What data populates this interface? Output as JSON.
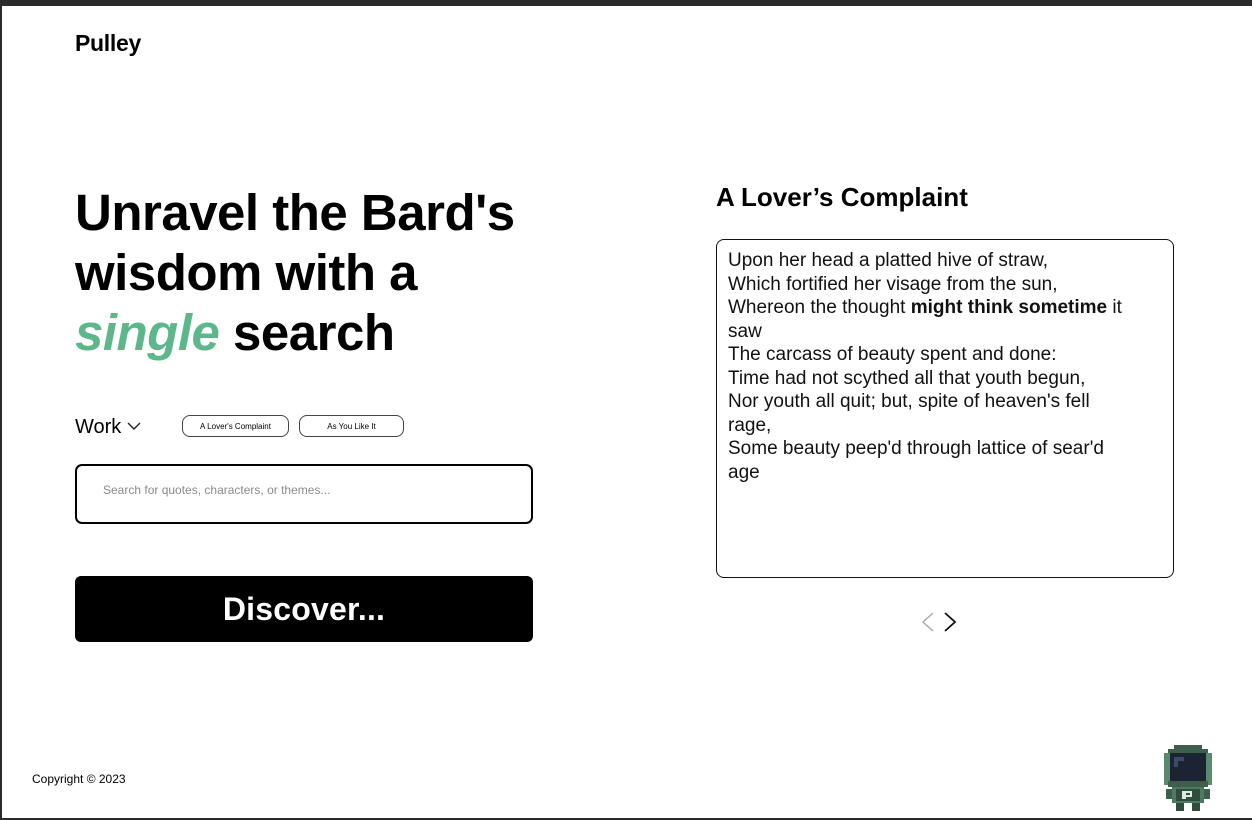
{
  "brand": {
    "logo_text": "Pulley"
  },
  "hero": {
    "line1": "Unravel the Bard's",
    "line2": "wisdom with a",
    "accent_word": "single",
    "line3_rest": " search",
    "accent_color": "#5cb88a"
  },
  "filters": {
    "work_label": "Work",
    "chips": [
      "A Lover's Complaint",
      "As You Like It"
    ]
  },
  "search": {
    "placeholder": "Search for quotes, characters, or themes...",
    "value": ""
  },
  "discover_button": {
    "label": "Discover..."
  },
  "result": {
    "title": "A Lover’s Complaint",
    "lines": [
      {
        "text": "Upon her head a platted hive of straw,"
      },
      {
        "text": "Which fortified her visage from the sun,"
      },
      {
        "before": "Whereon the thought ",
        "bold": "might think sometime",
        "after": " it"
      },
      {
        "text": "saw"
      },
      {
        "text": "The carcass of beauty spent and done:"
      },
      {
        "text": "Time had not scythed all that youth begun,"
      },
      {
        "text": "Nor youth all quit; but, spite of heaven's fell"
      },
      {
        "text": "rage,"
      },
      {
        "text": "Some beauty peep'd through lattice of sear'd"
      },
      {
        "text": "age"
      }
    ]
  },
  "pager": {
    "prev_icon": "chevron-left-icon",
    "next_icon": "chevron-right-icon"
  },
  "footer": {
    "copyright": "Copyright © 2023"
  },
  "mascot": {
    "icon": "pixel-astronaut-icon",
    "badge_letter": "P"
  }
}
